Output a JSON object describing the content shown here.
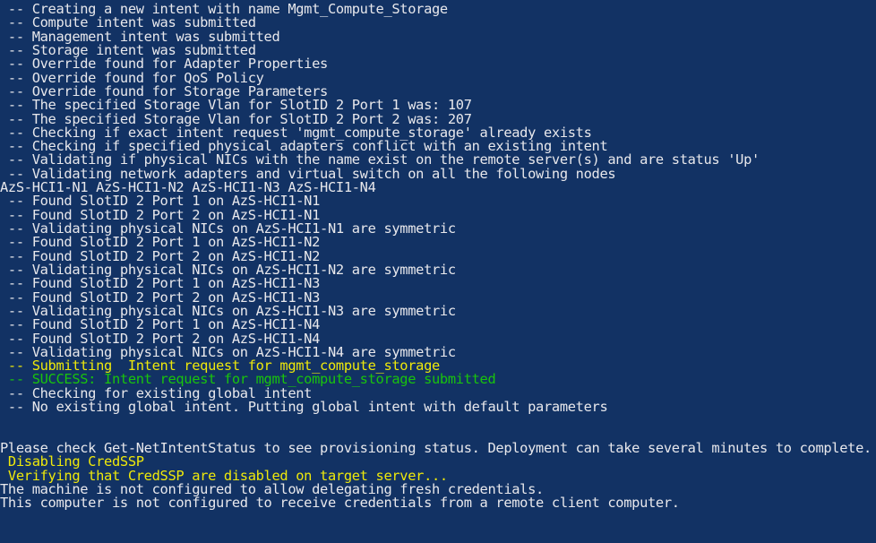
{
  "terminal": {
    "name": "powershell-console",
    "background_color": "#123264",
    "default_text_color": "#e8e8ec",
    "yellow_color": "#efe90a",
    "green_color": "#19c40c",
    "lines": [
      {
        "text": " -- Creating a new intent with name Mgmt_Compute_Storage",
        "color": "white"
      },
      {
        "text": " -- Compute intent was submitted",
        "color": "white"
      },
      {
        "text": " -- Management intent was submitted",
        "color": "white"
      },
      {
        "text": " -- Storage intent was submitted",
        "color": "white"
      },
      {
        "text": " -- Override found for Adapter Properties",
        "color": "white"
      },
      {
        "text": " -- Override found for QoS Policy",
        "color": "white"
      },
      {
        "text": " -- Override found for Storage Parameters",
        "color": "white"
      },
      {
        "text": " -- The specified Storage Vlan for SlotID 2 Port 1 was: 107",
        "color": "white"
      },
      {
        "text": " -- The specified Storage Vlan for SlotID 2 Port 2 was: 207",
        "color": "white"
      },
      {
        "text": " -- Checking if exact intent request 'mgmt_compute_storage' already exists",
        "color": "white"
      },
      {
        "text": " -- Checking if specified physical adapters conflict with an existing intent",
        "color": "white"
      },
      {
        "text": " -- Validating if physical NICs with the name exist on the remote server(s) and are status 'Up'",
        "color": "white"
      },
      {
        "text": " -- Validating network adapters and virtual switch on all the following nodes",
        "color": "white"
      },
      {
        "text": "AzS-HCI1-N1 AzS-HCI1-N2 AzS-HCI1-N3 AzS-HCI1-N4",
        "color": "white"
      },
      {
        "text": " -- Found SlotID 2 Port 1 on AzS-HCI1-N1",
        "color": "white"
      },
      {
        "text": " -- Found SlotID 2 Port 2 on AzS-HCI1-N1",
        "color": "white"
      },
      {
        "text": " -- Validating physical NICs on AzS-HCI1-N1 are symmetric",
        "color": "white"
      },
      {
        "text": " -- Found SlotID 2 Port 1 on AzS-HCI1-N2",
        "color": "white"
      },
      {
        "text": " -- Found SlotID 2 Port 2 on AzS-HCI1-N2",
        "color": "white"
      },
      {
        "text": " -- Validating physical NICs on AzS-HCI1-N2 are symmetric",
        "color": "white"
      },
      {
        "text": " -- Found SlotID 2 Port 1 on AzS-HCI1-N3",
        "color": "white"
      },
      {
        "text": " -- Found SlotID 2 Port 2 on AzS-HCI1-N3",
        "color": "white"
      },
      {
        "text": " -- Validating physical NICs on AzS-HCI1-N3 are symmetric",
        "color": "white"
      },
      {
        "text": " -- Found SlotID 2 Port 1 on AzS-HCI1-N4",
        "color": "white"
      },
      {
        "text": " -- Found SlotID 2 Port 2 on AzS-HCI1-N4",
        "color": "white"
      },
      {
        "text": " -- Validating physical NICs on AzS-HCI1-N4 are symmetric",
        "color": "white"
      },
      {
        "text": " -- Submitting  Intent request for mgmt_compute_storage",
        "color": "yellow"
      },
      {
        "text": " -- SUCCESS: Intent request for mgmt_compute_storage submitted",
        "color": "green"
      },
      {
        "text": " -- Checking for existing global intent",
        "color": "white"
      },
      {
        "text": " -- No existing global intent. Putting global intent with default parameters",
        "color": "white"
      },
      {
        "text": "",
        "color": "white"
      },
      {
        "text": "",
        "color": "white"
      },
      {
        "text": "Please check Get-NetIntentStatus to see provisioning status. Deployment can take several minutes to complete.",
        "color": "white"
      },
      {
        "text": " Disabling CredSSP",
        "color": "yellow"
      },
      {
        "text": " Verifying that CredSSP are disabled on target server...",
        "color": "yellow"
      },
      {
        "text": "The machine is not configured to allow delegating fresh credentials.",
        "color": "white"
      },
      {
        "text": "This computer is not configured to receive credentials from a remote client computer.",
        "color": "white"
      }
    ]
  }
}
